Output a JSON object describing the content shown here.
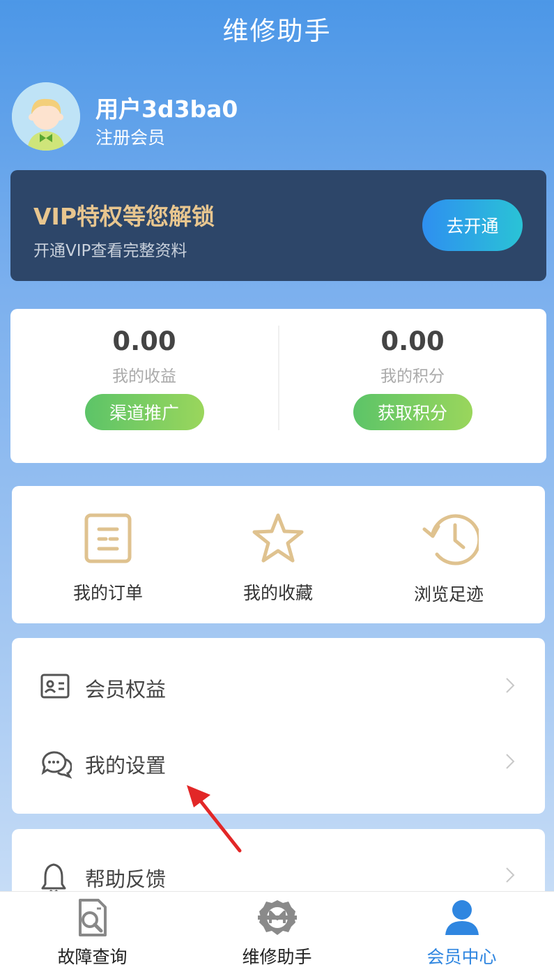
{
  "header": {
    "title": "维修助手"
  },
  "user": {
    "name": "用户3d3ba0",
    "level": "注册会员"
  },
  "vip": {
    "title": "VIP特权等您解锁",
    "subtitle": "开通VIP查看完整资料",
    "button": "去开通"
  },
  "stats": {
    "earnings": {
      "value": "0.00",
      "label": "我的收益",
      "button": "渠道推广"
    },
    "points": {
      "value": "0.00",
      "label": "我的积分",
      "button": "获取积分"
    }
  },
  "quick_links": [
    {
      "label": "我的订单",
      "icon": "order-list-icon"
    },
    {
      "label": "我的收藏",
      "icon": "star-icon"
    },
    {
      "label": "浏览足迹",
      "icon": "history-clock-icon"
    }
  ],
  "menu": [
    {
      "label": "会员权益",
      "icon": "id-card-icon"
    },
    {
      "label": "我的设置",
      "icon": "chat-bubbles-icon"
    },
    {
      "label": "帮助反馈",
      "icon": "bell-icon"
    }
  ],
  "tabbar": [
    {
      "label": "故障查询",
      "icon": "document-search-icon",
      "active": false
    },
    {
      "label": "维修助手",
      "icon": "repair-logo-icon",
      "active": false
    },
    {
      "label": "会员中心",
      "icon": "user-icon",
      "active": true
    }
  ],
  "colors": {
    "primary": "#2f86e0",
    "vip_gold": "#e8c68f",
    "vip_bg": "#2d4669",
    "green_button": "#5cc468",
    "icon_gold": "#dfc28f"
  }
}
